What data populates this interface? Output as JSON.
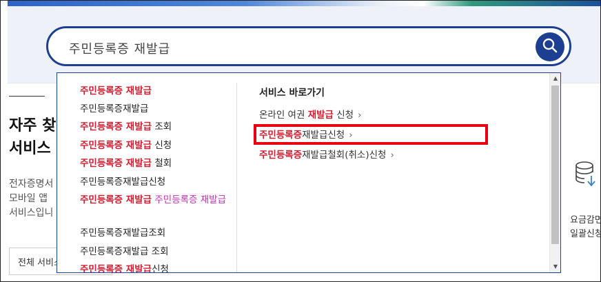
{
  "search": {
    "query": "주민등록증 재발급",
    "button_icon": "search-icon"
  },
  "sidebar": {
    "heading_line1": "자주 찾",
    "heading_line2": "서비스",
    "desc_line1": "전자증명서",
    "desc_line2": "모바일 앱",
    "desc_line3": "서비스입니",
    "all_button": "전체 서비스"
  },
  "right_card": {
    "icon": "database-download-icon",
    "line1": "요금감면",
    "line2": "일괄신청"
  },
  "suggestions": [
    {
      "parts": [
        {
          "t": "주민등록증 재발급",
          "s": "hl"
        }
      ]
    },
    {
      "parts": [
        {
          "t": "주민등록증재발급",
          "s": ""
        }
      ]
    },
    {
      "parts": [
        {
          "t": "주민등록증 재발급",
          "s": "hl"
        },
        {
          "t": " 조회",
          "s": ""
        }
      ]
    },
    {
      "parts": [
        {
          "t": "주민등록증 재발급",
          "s": "hl"
        },
        {
          "t": " 신청",
          "s": ""
        }
      ]
    },
    {
      "parts": [
        {
          "t": "주민등록증 재발급",
          "s": "hl"
        },
        {
          "t": " 철회",
          "s": ""
        }
      ]
    },
    {
      "parts": [
        {
          "t": "주민등록증재발급신청",
          "s": ""
        }
      ]
    },
    {
      "parts": [
        {
          "t": "주민등록증 재발급",
          "s": "hl"
        },
        {
          "t": " 주민등록증 재발급",
          "s": "pk"
        }
      ]
    },
    {
      "parts": [
        {
          "t": "주민등록증재발급조회",
          "s": ""
        }
      ]
    },
    {
      "parts": [
        {
          "t": "주민등록증재발급 조회",
          "s": ""
        }
      ]
    },
    {
      "parts": [
        {
          "t": "주민등록증 재발급",
          "s": "hl"
        },
        {
          "t": "신청",
          "s": ""
        }
      ]
    }
  ],
  "services": {
    "title": "서비스 바로가기",
    "links": [
      {
        "parts": [
          {
            "t": "온라인 여권 ",
            "s": ""
          },
          {
            "t": "재발급",
            "s": "hl"
          },
          {
            "t": " 신청",
            "s": ""
          }
        ]
      },
      {
        "parts": [
          {
            "t": "주민등록증",
            "s": "hl"
          },
          {
            "t": "재발급신청",
            "s": ""
          }
        ]
      },
      {
        "parts": [
          {
            "t": "주민등록증",
            "s": "hl"
          },
          {
            "t": "재발급철회(취소)신청",
            "s": ""
          }
        ]
      }
    ],
    "chevron": "›"
  },
  "scrollbar": {
    "up_glyph": "▲",
    "down_glyph": "▼"
  },
  "colors": {
    "brand_navy": "#1d3f91",
    "highlight_red": "#d21e31",
    "highlight_pink": "#c033b0",
    "annotation_box": "#e60012"
  }
}
